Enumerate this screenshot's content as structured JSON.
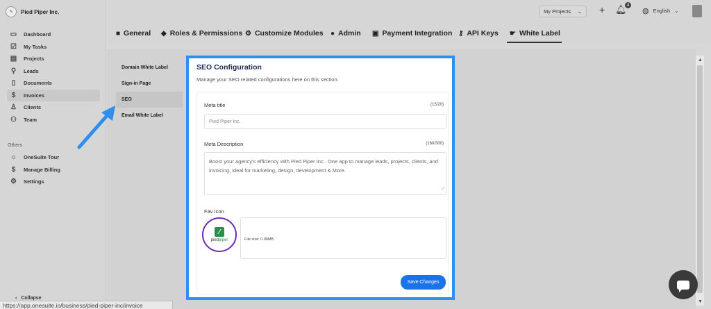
{
  "brand": {
    "name": "Pied Piper Inc."
  },
  "sidebar": {
    "items": [
      {
        "label": "Dashboard",
        "icon": "dashboard-icon"
      },
      {
        "label": "My Tasks",
        "icon": "tasks-icon"
      },
      {
        "label": "Projects",
        "icon": "projects-icon"
      },
      {
        "label": "Leads",
        "icon": "leads-icon"
      },
      {
        "label": "Documents",
        "icon": "documents-icon"
      },
      {
        "label": "Invoices",
        "icon": "invoices-icon",
        "active": true
      },
      {
        "label": "Clients",
        "icon": "clients-icon"
      },
      {
        "label": "Team",
        "icon": "team-icon"
      }
    ],
    "others_label": "Others",
    "others": [
      {
        "label": "OneSuite Tour",
        "icon": "tour-icon"
      },
      {
        "label": "Manage Billing",
        "icon": "dollar-icon"
      },
      {
        "label": "Settings",
        "icon": "gear-icon"
      }
    ],
    "collapse_label": "Collapse"
  },
  "topbar": {
    "project_select": "My Projects",
    "notification_count": "4",
    "language": "English"
  },
  "tabs": [
    {
      "label": "General",
      "icon": "briefcase-icon"
    },
    {
      "label": "Roles & Permissions",
      "icon": "shield-icon"
    },
    {
      "label": "Customize Modules",
      "icon": "gear-icon"
    },
    {
      "label": "Admin",
      "icon": "admin-icon"
    },
    {
      "label": "Payment Integration",
      "icon": "payment-icon"
    },
    {
      "label": "API Keys",
      "icon": "key-icon"
    },
    {
      "label": "White Label",
      "icon": "white-label-icon",
      "active": true
    }
  ],
  "submenu": [
    {
      "label": "Domain White Label"
    },
    {
      "label": "Sign-in Page"
    },
    {
      "label": "SEO",
      "active": true
    },
    {
      "label": "Email White Label"
    }
  ],
  "seo": {
    "title": "SEO Configuration",
    "subtitle": "Manage your SEO related configurations here on this section.",
    "meta_title_label": "Meta title",
    "meta_title_count": "(15/20)",
    "meta_title_value": "Pied Piper Inc.",
    "meta_desc_label": "Meta Description",
    "meta_desc_count": "(160/300)",
    "meta_desc_value": "Boost your agency's efficiency with Pied Piper Inc.. One app to manage leads, projects, clients, and invoicing, ideal for marketing, design, development & More.",
    "fav_icon_label": "Fav Icon",
    "fav_logo_text_a": "pied",
    "fav_logo_text_b": "piper",
    "file_size": "File size: 0.00MB",
    "save_label": "Save Changes"
  },
  "status_url": "https://app.onesuite.io/business/pied-piper-inc/invoice",
  "colors": {
    "accent": "#1a73e8",
    "highlight_border": "#2f8ef0",
    "fav_ring": "#6a2bb8",
    "brand_green": "#2a8f4a"
  }
}
